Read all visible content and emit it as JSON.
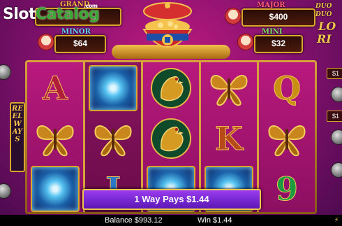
{
  "watermark": {
    "slot": "Slot",
    "catalog": "Catalog",
    "com": ".com"
  },
  "jackpots": {
    "grand": {
      "label": "GRAND",
      "value": ""
    },
    "major": {
      "label": "MAJOR",
      "value": "$400"
    },
    "minor": {
      "label": "MINOR",
      "value": "$64"
    },
    "mini": {
      "label": "MINI",
      "value": "$32"
    }
  },
  "logo": {
    "line1": "DUO",
    "line2": "DUO",
    "line3": "LO",
    "line4": "RI"
  },
  "reel_ways": {
    "label": "REEL WAYS"
  },
  "reels": [
    [
      "A",
      "butterfly",
      "orb"
    ],
    [
      "orb",
      "butterfly",
      "J"
    ],
    [
      "rooster",
      "rooster",
      "orb"
    ],
    [
      "butterfly",
      "K",
      "orb"
    ],
    [
      "Q",
      "butterfly",
      "9"
    ]
  ],
  "side_tags": {
    "right_top": "$1",
    "right_mid": "$1"
  },
  "win_banner": {
    "text": "1 Way Pays $1.44"
  },
  "status": {
    "balance": "Balance $993.12",
    "win": "Win $1.44"
  },
  "colors": {
    "accent": "#d9a52a",
    "banner": "#7a2ad6",
    "background": "#8a1270"
  }
}
